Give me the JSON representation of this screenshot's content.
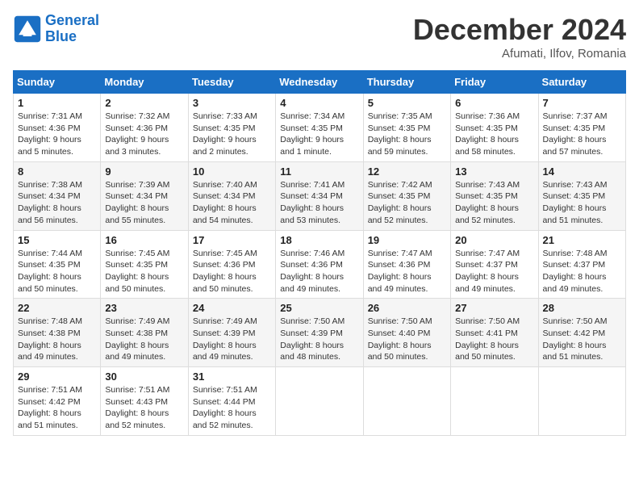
{
  "header": {
    "logo_line1": "General",
    "logo_line2": "Blue",
    "month": "December 2024",
    "location": "Afumati, Ilfov, Romania"
  },
  "weekdays": [
    "Sunday",
    "Monday",
    "Tuesday",
    "Wednesday",
    "Thursday",
    "Friday",
    "Saturday"
  ],
  "weeks": [
    [
      {
        "day": "1",
        "info": "Sunrise: 7:31 AM\nSunset: 4:36 PM\nDaylight: 9 hours\nand 5 minutes."
      },
      {
        "day": "2",
        "info": "Sunrise: 7:32 AM\nSunset: 4:36 PM\nDaylight: 9 hours\nand 3 minutes."
      },
      {
        "day": "3",
        "info": "Sunrise: 7:33 AM\nSunset: 4:35 PM\nDaylight: 9 hours\nand 2 minutes."
      },
      {
        "day": "4",
        "info": "Sunrise: 7:34 AM\nSunset: 4:35 PM\nDaylight: 9 hours\nand 1 minute."
      },
      {
        "day": "5",
        "info": "Sunrise: 7:35 AM\nSunset: 4:35 PM\nDaylight: 8 hours\nand 59 minutes."
      },
      {
        "day": "6",
        "info": "Sunrise: 7:36 AM\nSunset: 4:35 PM\nDaylight: 8 hours\nand 58 minutes."
      },
      {
        "day": "7",
        "info": "Sunrise: 7:37 AM\nSunset: 4:35 PM\nDaylight: 8 hours\nand 57 minutes."
      }
    ],
    [
      {
        "day": "8",
        "info": "Sunrise: 7:38 AM\nSunset: 4:34 PM\nDaylight: 8 hours\nand 56 minutes."
      },
      {
        "day": "9",
        "info": "Sunrise: 7:39 AM\nSunset: 4:34 PM\nDaylight: 8 hours\nand 55 minutes."
      },
      {
        "day": "10",
        "info": "Sunrise: 7:40 AM\nSunset: 4:34 PM\nDaylight: 8 hours\nand 54 minutes."
      },
      {
        "day": "11",
        "info": "Sunrise: 7:41 AM\nSunset: 4:34 PM\nDaylight: 8 hours\nand 53 minutes."
      },
      {
        "day": "12",
        "info": "Sunrise: 7:42 AM\nSunset: 4:35 PM\nDaylight: 8 hours\nand 52 minutes."
      },
      {
        "day": "13",
        "info": "Sunrise: 7:43 AM\nSunset: 4:35 PM\nDaylight: 8 hours\nand 52 minutes."
      },
      {
        "day": "14",
        "info": "Sunrise: 7:43 AM\nSunset: 4:35 PM\nDaylight: 8 hours\nand 51 minutes."
      }
    ],
    [
      {
        "day": "15",
        "info": "Sunrise: 7:44 AM\nSunset: 4:35 PM\nDaylight: 8 hours\nand 50 minutes."
      },
      {
        "day": "16",
        "info": "Sunrise: 7:45 AM\nSunset: 4:35 PM\nDaylight: 8 hours\nand 50 minutes."
      },
      {
        "day": "17",
        "info": "Sunrise: 7:45 AM\nSunset: 4:36 PM\nDaylight: 8 hours\nand 50 minutes."
      },
      {
        "day": "18",
        "info": "Sunrise: 7:46 AM\nSunset: 4:36 PM\nDaylight: 8 hours\nand 49 minutes."
      },
      {
        "day": "19",
        "info": "Sunrise: 7:47 AM\nSunset: 4:36 PM\nDaylight: 8 hours\nand 49 minutes."
      },
      {
        "day": "20",
        "info": "Sunrise: 7:47 AM\nSunset: 4:37 PM\nDaylight: 8 hours\nand 49 minutes."
      },
      {
        "day": "21",
        "info": "Sunrise: 7:48 AM\nSunset: 4:37 PM\nDaylight: 8 hours\nand 49 minutes."
      }
    ],
    [
      {
        "day": "22",
        "info": "Sunrise: 7:48 AM\nSunset: 4:38 PM\nDaylight: 8 hours\nand 49 minutes."
      },
      {
        "day": "23",
        "info": "Sunrise: 7:49 AM\nSunset: 4:38 PM\nDaylight: 8 hours\nand 49 minutes."
      },
      {
        "day": "24",
        "info": "Sunrise: 7:49 AM\nSunset: 4:39 PM\nDaylight: 8 hours\nand 49 minutes."
      },
      {
        "day": "25",
        "info": "Sunrise: 7:50 AM\nSunset: 4:39 PM\nDaylight: 8 hours\nand 48 minutes."
      },
      {
        "day": "26",
        "info": "Sunrise: 7:50 AM\nSunset: 4:40 PM\nDaylight: 8 hours\nand 50 minutes."
      },
      {
        "day": "27",
        "info": "Sunrise: 7:50 AM\nSunset: 4:41 PM\nDaylight: 8 hours\nand 50 minutes."
      },
      {
        "day": "28",
        "info": "Sunrise: 7:50 AM\nSunset: 4:42 PM\nDaylight: 8 hours\nand 51 minutes."
      }
    ],
    [
      {
        "day": "29",
        "info": "Sunrise: 7:51 AM\nSunset: 4:42 PM\nDaylight: 8 hours\nand 51 minutes."
      },
      {
        "day": "30",
        "info": "Sunrise: 7:51 AM\nSunset: 4:43 PM\nDaylight: 8 hours\nand 52 minutes."
      },
      {
        "day": "31",
        "info": "Sunrise: 7:51 AM\nSunset: 4:44 PM\nDaylight: 8 hours\nand 52 minutes."
      },
      null,
      null,
      null,
      null
    ]
  ]
}
